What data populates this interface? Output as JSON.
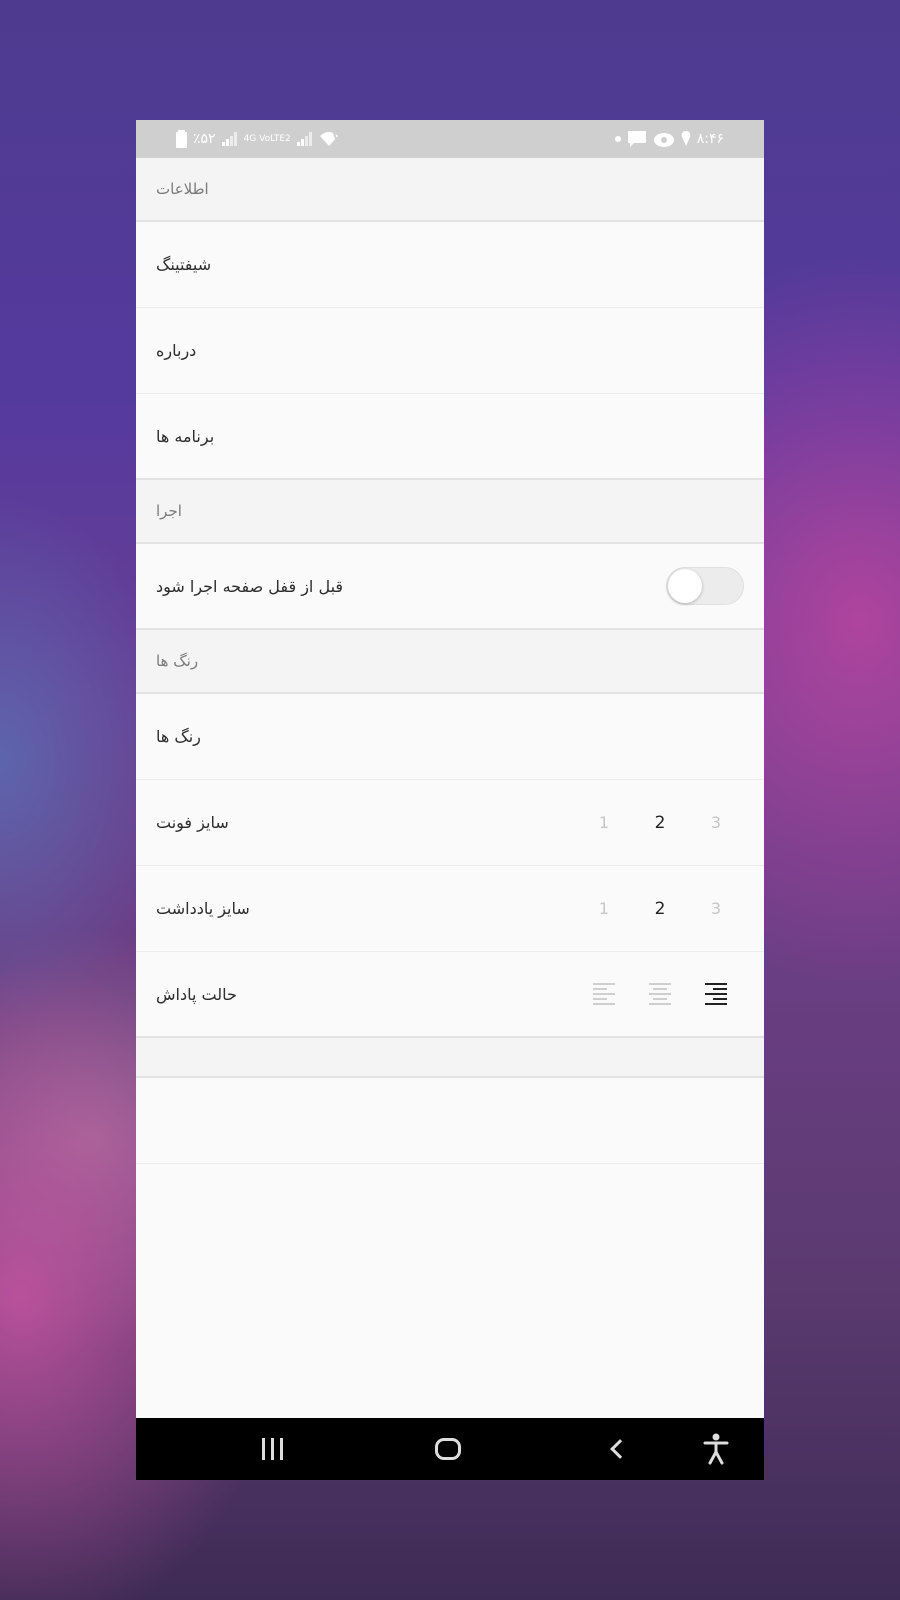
{
  "status_bar": {
    "battery": "٪۵۲",
    "network": "4G VoLTE2",
    "time": "۸:۴۶"
  },
  "sections": {
    "info": {
      "header": "اطلاعات",
      "items": [
        "شیفتینگ",
        "درباره",
        "برنامه ها"
      ]
    },
    "run": {
      "header": "اجرا",
      "toggle_label": "قبل از قفل صفحه اجرا شود",
      "toggle_on": false
    },
    "colors": {
      "header": "رنگ ها",
      "colors_item": "رنگ ها",
      "font_size": {
        "label": "سایز فونت",
        "options": [
          "1",
          "2",
          "3"
        ],
        "selected": "2"
      },
      "note_size": {
        "label": "سایز یادداشت",
        "options": [
          "1",
          "2",
          "3"
        ],
        "selected": "2"
      },
      "reward_mode": {
        "label": "حالت پاداش",
        "selected": "right"
      }
    }
  },
  "icons": {
    "nav": [
      "recent-apps-icon",
      "home-icon",
      "back-icon",
      "accessibility-icon"
    ]
  },
  "colors": {
    "status_bar_bg": "#cfcfcf",
    "section_bg": "#f4f4f4",
    "row_bg": "#fafafa",
    "nav_bg": "#000000"
  }
}
